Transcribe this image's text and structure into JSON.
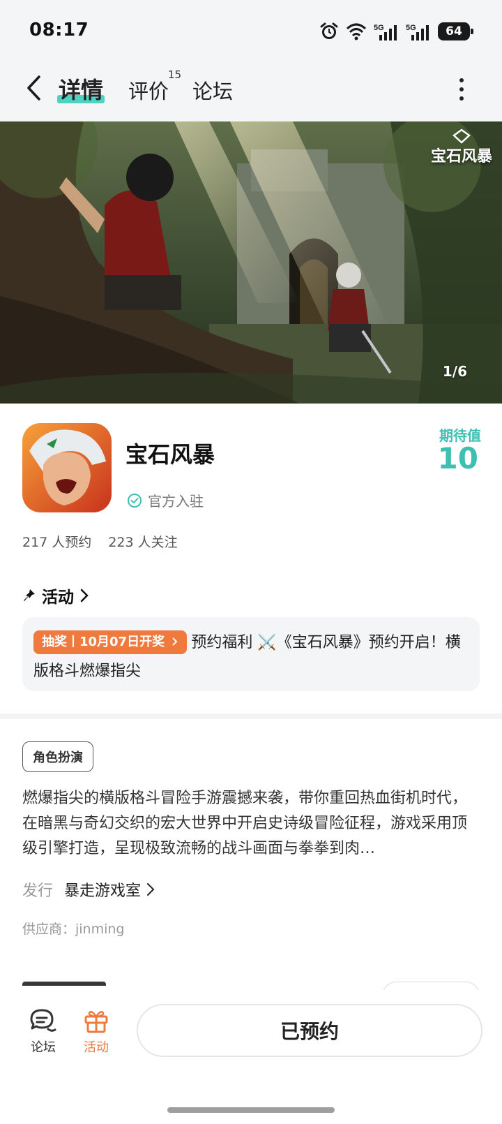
{
  "status_bar": {
    "time": "08:17",
    "battery": "64",
    "network_1": "5G",
    "network_2": "5G",
    "icons": [
      "alarm-icon",
      "wifi-icon",
      "signal-icon",
      "signal-icon",
      "battery-icon"
    ]
  },
  "nav": {
    "tabs": [
      {
        "label": "详情",
        "active": true
      },
      {
        "label": "评价",
        "badge": "15"
      },
      {
        "label": "论坛"
      }
    ]
  },
  "banner": {
    "counter": "1/6",
    "logo_text": "宝石风暴"
  },
  "game": {
    "name": "宝石风暴",
    "official_label": "官方入驻",
    "expect_label": "期待值",
    "expect_value": "10",
    "reservations": "217 人预约",
    "followers": "223 人关注"
  },
  "activity": {
    "title": "活动",
    "badge": "抽奖丨10月07日开奖",
    "text": "预约福利 ⚔️《宝石风暴》预约开启！横版格斗燃爆指尖"
  },
  "details": {
    "tag": "角色扮演",
    "description": "燃爆指尖的横版格斗冒险手游震撼来袭，带你重回热血街机时代，在暗黑与奇幻交织的宏大世界中开启史诗级冒险征程，游戏采用顶级引擎打造，呈现极致流畅的战斗画面与拳拳到肉…",
    "publisher_label": "发行",
    "publisher_name": "暴走游戏室",
    "supplier": "供应商：jinming"
  },
  "bottom_bar": {
    "forum_label": "论坛",
    "activity_label": "活动",
    "reserved_button": "已预约"
  },
  "colors": {
    "accent_teal": "#3fbfb1",
    "tab_underline": "#4fd2c2",
    "orange": "#f07a3e"
  }
}
